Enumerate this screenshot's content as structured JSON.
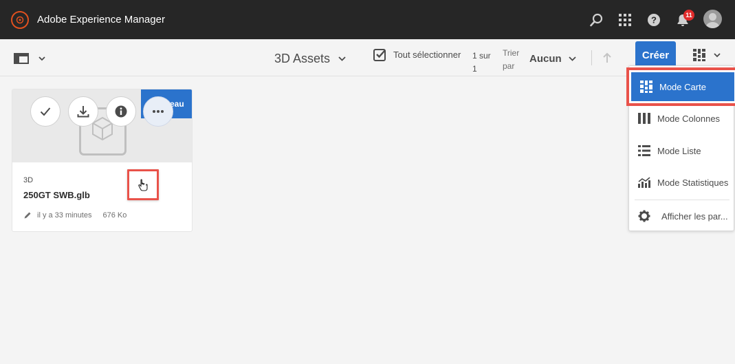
{
  "header": {
    "app_title": "Adobe Experience Manager",
    "notification_count": "11",
    "icons": [
      "adobe-logo-icon",
      "search-icon",
      "apps-grid-icon",
      "help-icon",
      "bell-icon",
      "avatar"
    ]
  },
  "actionbar": {
    "folder_title": "3D Assets",
    "select_all_label": "Tout sélectionner",
    "count_line1": "1 sur",
    "count_line2": "1",
    "sort_label_line1": "Trier",
    "sort_label_line2": "par",
    "sort_value": "Aucun",
    "create_label": "Créer"
  },
  "card": {
    "new_badge": "Nouveau",
    "type": "3D",
    "name": "250GT SWB.glb",
    "modified": "il y a 33 minutes",
    "size": "676 Ko"
  },
  "view_menu": {
    "items": [
      {
        "label": "Mode Carte",
        "icon": "card-view-icon",
        "selected": true
      },
      {
        "label": "Mode Colonnes",
        "icon": "column-view-icon",
        "selected": false
      },
      {
        "label": "Mode Liste",
        "icon": "list-view-icon",
        "selected": false
      },
      {
        "label": "Mode Statistiques",
        "icon": "statistics-view-icon",
        "selected": false
      },
      {
        "label": "Afficher les par...",
        "icon": "gear-icon",
        "selected": false
      }
    ]
  },
  "colors": {
    "topbar": "#262626",
    "accent": "#2b73cc",
    "highlight": "#e9524a",
    "badge": "#e02b2b",
    "adobe_orange": "#e1511f"
  }
}
